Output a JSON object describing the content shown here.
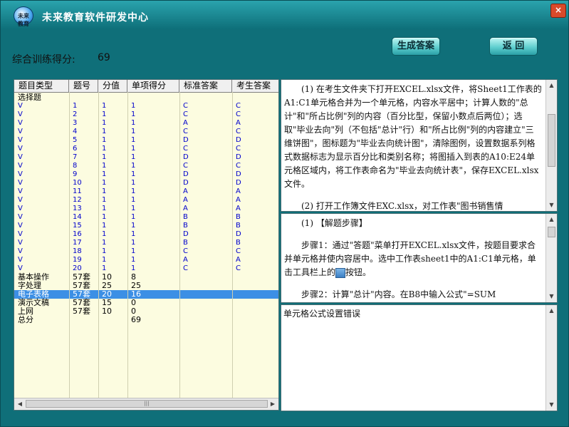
{
  "app": {
    "title": "未来教育软件研发中心",
    "logo_text": "未来教育",
    "close_label": "×"
  },
  "score": {
    "label": "综合训练得分:",
    "value": "69"
  },
  "buttons": {
    "generate": "生成答案",
    "back": "返 回"
  },
  "table": {
    "columns": [
      "题目类型",
      "题号",
      "分值",
      "单项得分",
      "标准答案",
      "考生答案"
    ],
    "category_choice": "选择题",
    "choice_rows": [
      [
        "V",
        "1",
        "1",
        "1",
        "C",
        "C"
      ],
      [
        "V",
        "2",
        "1",
        "1",
        "C",
        "C"
      ],
      [
        "V",
        "3",
        "1",
        "1",
        "A",
        "A"
      ],
      [
        "V",
        "4",
        "1",
        "1",
        "C",
        "C"
      ],
      [
        "V",
        "5",
        "1",
        "1",
        "D",
        "D"
      ],
      [
        "V",
        "6",
        "1",
        "1",
        "C",
        "C"
      ],
      [
        "V",
        "7",
        "1",
        "1",
        "D",
        "D"
      ],
      [
        "V",
        "8",
        "1",
        "1",
        "C",
        "C"
      ],
      [
        "V",
        "9",
        "1",
        "1",
        "D",
        "D"
      ],
      [
        "V",
        "10",
        "1",
        "1",
        "D",
        "D"
      ],
      [
        "V",
        "11",
        "1",
        "1",
        "A",
        "A"
      ],
      [
        "V",
        "12",
        "1",
        "1",
        "A",
        "A"
      ],
      [
        "V",
        "13",
        "1",
        "1",
        "A",
        "A"
      ],
      [
        "V",
        "14",
        "1",
        "1",
        "B",
        "B"
      ],
      [
        "V",
        "15",
        "1",
        "1",
        "B",
        "B"
      ],
      [
        "V",
        "16",
        "1",
        "1",
        "D",
        "D"
      ],
      [
        "V",
        "17",
        "1",
        "1",
        "B",
        "B"
      ],
      [
        "V",
        "18",
        "1",
        "1",
        "C",
        "C"
      ],
      [
        "V",
        "19",
        "1",
        "1",
        "A",
        "A"
      ],
      [
        "V",
        "20",
        "1",
        "1",
        "C",
        "C"
      ]
    ],
    "category_rows": [
      [
        "基本操作",
        "57套",
        "10",
        "8"
      ],
      [
        "字处理",
        "57套",
        "25",
        "25"
      ],
      [
        "电子表格",
        "57套",
        "20",
        "16"
      ],
      [
        "演示文稿",
        "57套",
        "15",
        "0"
      ],
      [
        "上网",
        "57套",
        "10",
        "0"
      ],
      [
        "总分",
        "",
        "",
        "69"
      ]
    ],
    "selected_index": 2
  },
  "question": {
    "p1": "(1) 在考生文件夹下打开EXCEL.xlsx文件，将Sheet1工作表的A1:C1单元格合并为一个单元格，内容水平居中；计算人数的\"总计\"和\"所占比例\"列的内容（百分比型，保留小数点后两位）；选取\"毕业去向\"列（不包括\"总计\"行）和\"所占比例\"列的内容建立\"三维饼图\"，图标题为\"毕业去向统计图\"，清除图例，设置数据系列格式数据标志为显示百分比和类别名称；将图插入到表的A10:E24单元格区域内，将工作表命名为\"毕业去向统计表\"，保存EXCEL.xlsx文件。",
    "p2": "(2) 打开工作簿文件EXC.xlsx，对工作表\"图书销售情"
  },
  "solution": {
    "p1": "(1) 【解题步骤】",
    "p2a": "步骤1：通过\"答题\"菜单打开EXCEL.xlsx文件，按题目要求合并单元格并使内容居中。选中工作表sheet1中的A1:C1单元格，单击工具栏上的",
    "p2b": "按钮。",
    "p3": "步骤2：计算\"总计\"内容。在B8中输入公式\"=SUM"
  },
  "result": {
    "text": "单元格公式设置错误"
  },
  "colors": {
    "titlebar": "#0e6f79",
    "selected_row": "#3c8fe5",
    "choice_text": "#0000cc"
  }
}
